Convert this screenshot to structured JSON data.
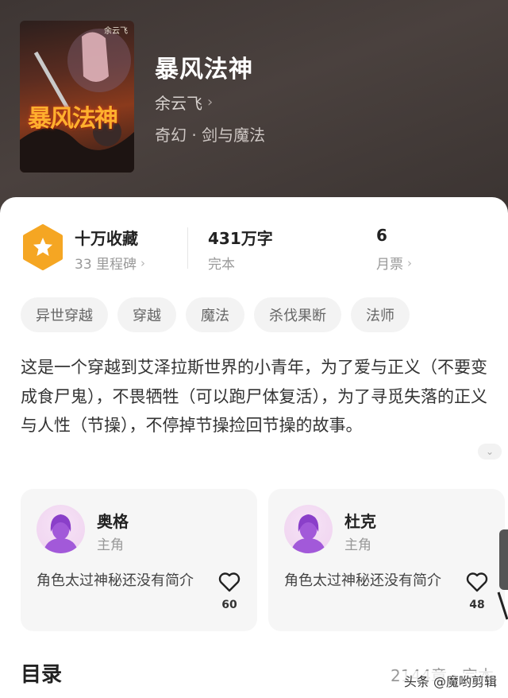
{
  "book": {
    "cover_title": "暴风法神",
    "cover_author": "余云飞",
    "title": "暴风法神",
    "author": "余云飞",
    "genre": "奇幻 · 剑与魔法"
  },
  "stats": {
    "collection_title": "十万收藏",
    "collection_sub": "33 里程碑",
    "words_title": "431万字",
    "words_sub": "完本",
    "tickets_title": "6",
    "tickets_sub": "月票"
  },
  "tags": [
    "异世穿越",
    "穿越",
    "魔法",
    "杀伐果断",
    "法师"
  ],
  "description": "这是一个穿越到艾泽拉斯世界的小青年，为了爱与正义（不要变成食尸鬼），不畏牺牲（可以跑尸体复活），为了寻觅失落的正义与人性（节操），不停掉节操捡回节操的故事。",
  "characters": [
    {
      "name": "奥格",
      "role": "主角",
      "desc": "角色太过神秘还没有简介",
      "likes": "60"
    },
    {
      "name": "杜克",
      "role": "主角",
      "desc": "角色太过神秘还没有简介",
      "likes": "48"
    }
  ],
  "toc": {
    "title": "目录",
    "meta": "2144章 · 完本"
  },
  "watermark": "头条 @魔哟剪辑",
  "colors": {
    "badge": "#f5a623",
    "header_bg": "#3e3634",
    "avatar_figure": "#a259d9"
  },
  "icons": [
    "star-badge-icon",
    "chevron-right-icon",
    "chevron-down-icon",
    "heart-icon",
    "person-silhouette-icon"
  ]
}
